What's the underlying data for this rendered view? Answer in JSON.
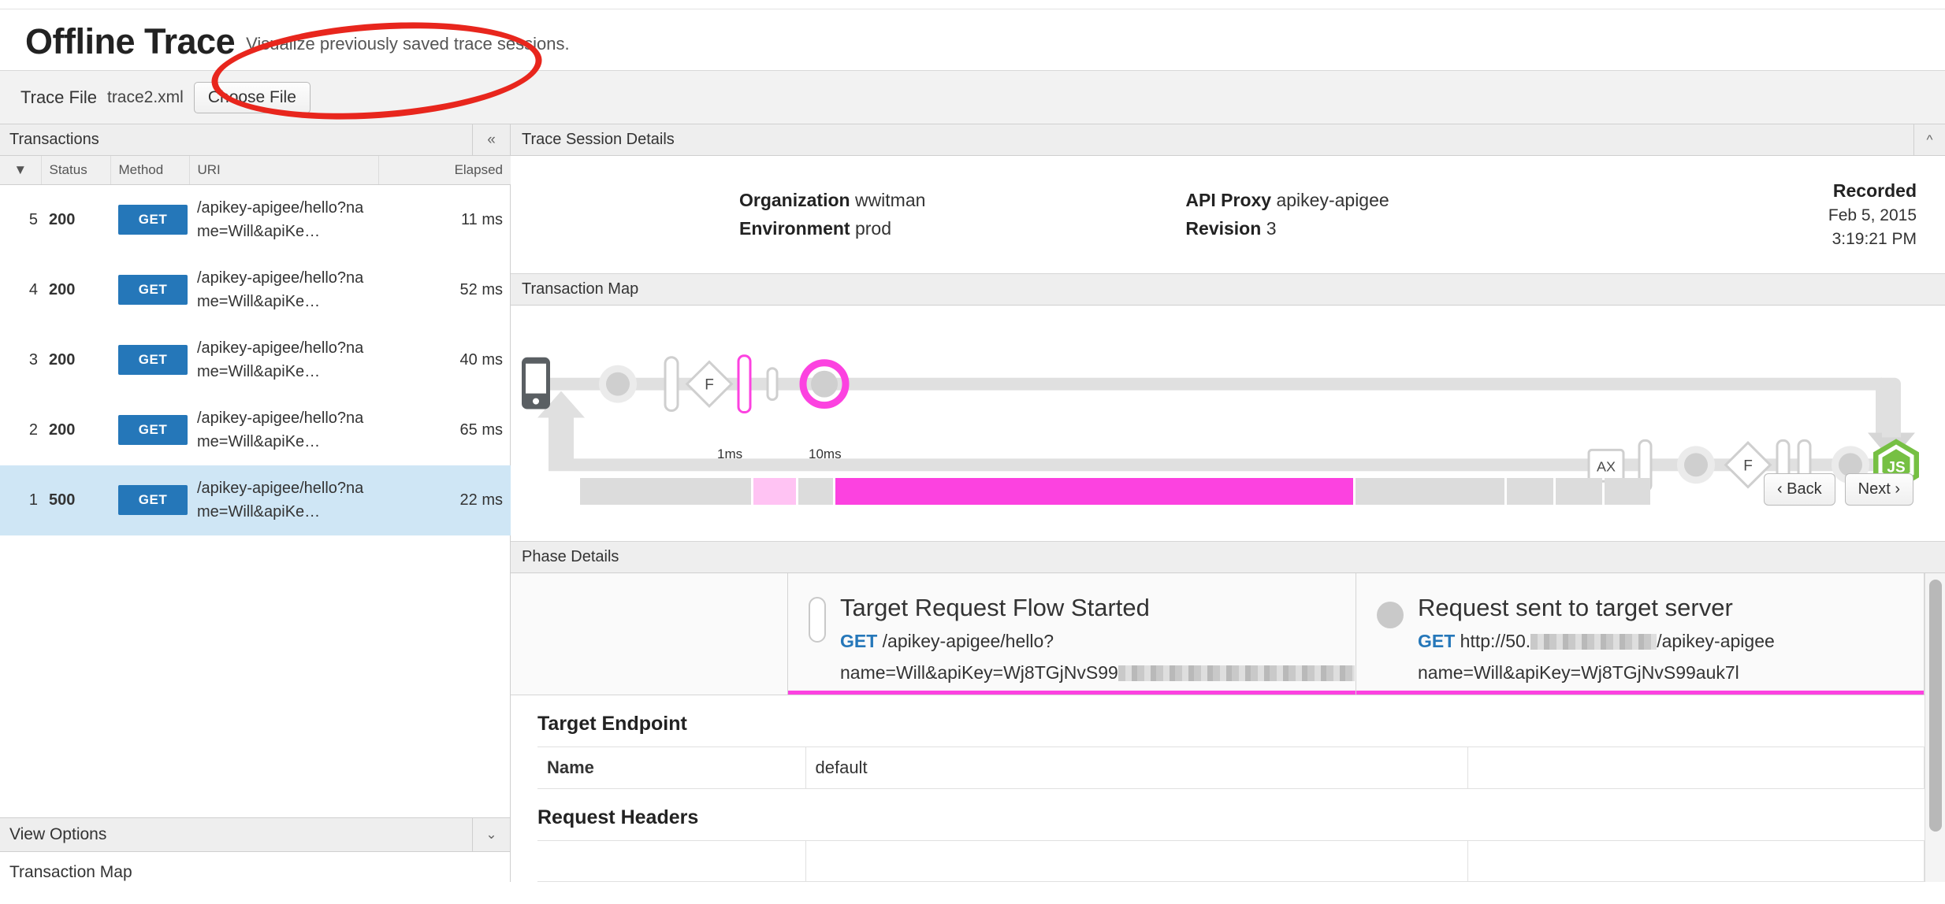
{
  "header": {
    "title": "Offline Trace",
    "subtitle": "Visualize previously saved trace sessions."
  },
  "trace_file_bar": {
    "label": "Trace File",
    "value": "trace2.xml",
    "button_label": "Choose File"
  },
  "transactions_panel": {
    "header_title": "Transactions",
    "collapse_icon": "double-chevron-left-icon",
    "columns": [
      "",
      "Status",
      "Method",
      "URI",
      "Elapsed"
    ],
    "sort_icon": "sort-descending-icon",
    "rows": [
      {
        "index": "5",
        "status": "200",
        "status_kind": "ok",
        "method": "GET",
        "uri": "/apikey-apigee/hello?name=Will&apiKe…",
        "elapsed": "11 ms",
        "selected": false
      },
      {
        "index": "4",
        "status": "200",
        "status_kind": "ok",
        "method": "GET",
        "uri": "/apikey-apigee/hello?name=Will&apiKe…",
        "elapsed": "52 ms",
        "selected": false
      },
      {
        "index": "3",
        "status": "200",
        "status_kind": "ok",
        "method": "GET",
        "uri": "/apikey-apigee/hello?name=Will&apiKe…",
        "elapsed": "40 ms",
        "selected": false
      },
      {
        "index": "2",
        "status": "200",
        "status_kind": "ok",
        "method": "GET",
        "uri": "/apikey-apigee/hello?name=Will&apiKe…",
        "elapsed": "65 ms",
        "selected": false
      },
      {
        "index": "1",
        "status": "500",
        "status_kind": "err",
        "method": "GET",
        "uri": "/apikey-apigee/hello?name=Will&apiKe…",
        "elapsed": "22 ms",
        "selected": true
      }
    ]
  },
  "view_options": {
    "header_title": "View Options",
    "chevron_icon": "double-chevron-down-icon",
    "items": [
      "Transaction Map"
    ]
  },
  "trace_session_details": {
    "header_title": "Trace Session Details",
    "chevron_icon": "chevron-up-icon",
    "organization_label": "Organization",
    "organization_value": "wwitman",
    "environment_label": "Environment",
    "environment_value": "prod",
    "api_proxy_label": "API Proxy",
    "api_proxy_value": "apikey-apigee",
    "revision_label": "Revision",
    "revision_value": "3",
    "recorded_label": "Recorded",
    "recorded_date": "Feb 5, 2015",
    "recorded_time": "3:19:21 PM"
  },
  "transaction_map": {
    "header_title": "Transaction Map",
    "client_icon": "mobile-device-icon",
    "analytics_badge": "AX",
    "flow_marker": "F",
    "target_icon": "nodejs-icon",
    "timeline": {
      "tick_labels": [
        "1ms",
        "10ms"
      ],
      "segments": [
        {
          "kind": "idle",
          "width_pct": 15.5
        },
        {
          "kind": "pink-light",
          "width_pct": 3.8
        },
        {
          "kind": "idle",
          "width_pct": 3.2
        },
        {
          "kind": "pink",
          "width_pct": 46.8
        },
        {
          "kind": "idle",
          "width_pct": 13.5
        },
        {
          "kind": "idle",
          "width_pct": 4.2
        },
        {
          "kind": "idle",
          "width_pct": 4.2
        },
        {
          "kind": "idle",
          "width_pct": 4.2
        }
      ],
      "back_label": "‹ Back",
      "next_label": "Next ›"
    }
  },
  "phase_details": {
    "header_title": "Phase Details",
    "cards": [
      {
        "icon": "pill-marker-icon",
        "title": "Target Request Flow Started",
        "method": "GET",
        "path": "/apikey-apigee/hello?",
        "query": "name=Will&apiKey=Wj8TGjNvS99",
        "redacted": true
      },
      {
        "icon": "circle-marker-icon",
        "title": "Request sent to target server",
        "method": "GET",
        "path": "http://50.",
        "path_suffix": "/apikey-apigee",
        "query": "name=Will&apiKey=Wj8TGjNvS99auk7l",
        "redacted": true
      }
    ]
  },
  "target_endpoint": {
    "title": "Target Endpoint",
    "rows": [
      {
        "key": "Name",
        "value": "default"
      }
    ]
  },
  "request_headers": {
    "title": "Request Headers"
  },
  "colors": {
    "accent_blue": "#2577b9",
    "status_ok": "#22a22a",
    "status_error": "#e8231a",
    "highlight_pink": "#fc42e0",
    "selection_blue": "#cfe6f5",
    "annotation_red": "#e8261d",
    "node_green": "#76c043"
  }
}
